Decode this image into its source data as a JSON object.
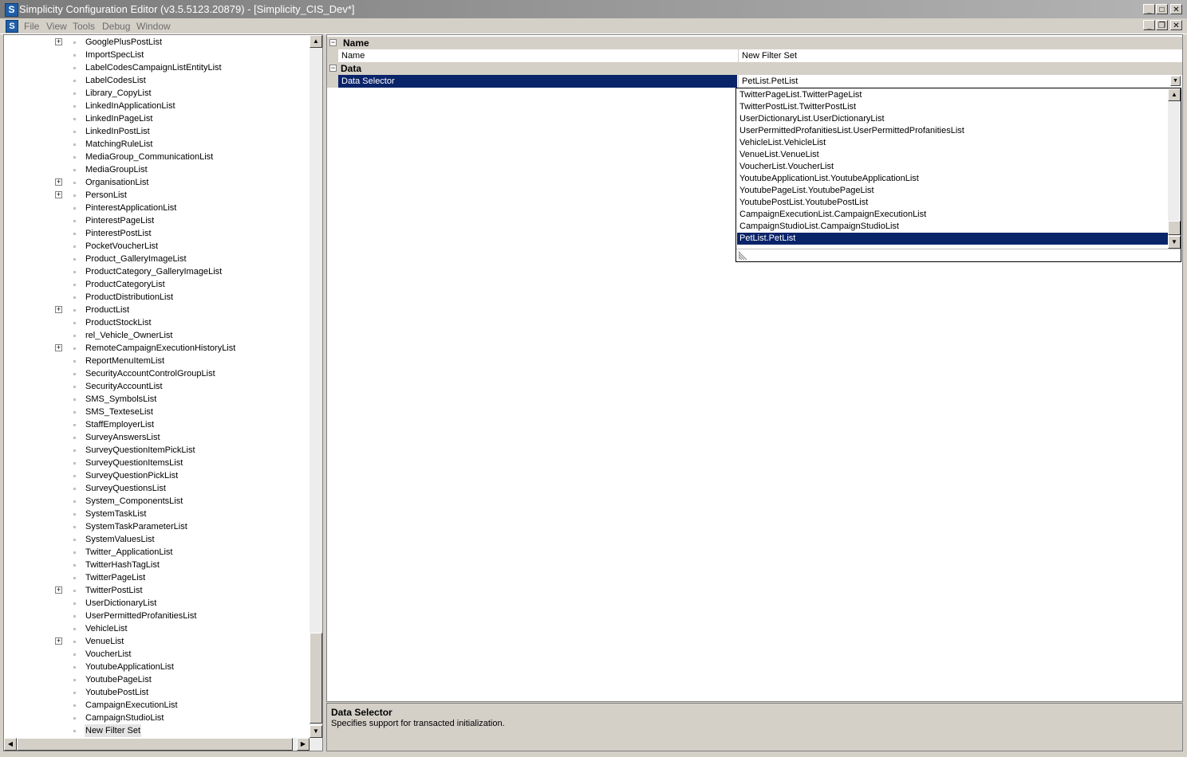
{
  "window": {
    "title": "Simplicity Configuration Editor (v3.5.5123.20879) - [Simplicity_CIS_Dev*]",
    "app_icon_letter": "S",
    "minimize_glyph": "_",
    "maximize_glyph": "□",
    "close_glyph": "✕",
    "restore_glyph": "❐"
  },
  "menu": [
    "File",
    "View",
    "Tools",
    "Debug",
    "Window"
  ],
  "tree": {
    "items": [
      {
        "label": "GooglePlusPostList",
        "expandable": true
      },
      {
        "label": "ImportSpecList",
        "expandable": false
      },
      {
        "label": "LabelCodesCampaignListEntityList",
        "expandable": false
      },
      {
        "label": "LabelCodesList",
        "expandable": false
      },
      {
        "label": "Library_CopyList",
        "expandable": false
      },
      {
        "label": "LinkedInApplicationList",
        "expandable": false
      },
      {
        "label": "LinkedInPageList",
        "expandable": false
      },
      {
        "label": "LinkedInPostList",
        "expandable": false
      },
      {
        "label": "MatchingRuleList",
        "expandable": false
      },
      {
        "label": "MediaGroup_CommunicationList",
        "expandable": false
      },
      {
        "label": "MediaGroupList",
        "expandable": false
      },
      {
        "label": "OrganisationList",
        "expandable": true
      },
      {
        "label": "PersonList",
        "expandable": true
      },
      {
        "label": "PinterestApplicationList",
        "expandable": false
      },
      {
        "label": "PinterestPageList",
        "expandable": false
      },
      {
        "label": "PinterestPostList",
        "expandable": false
      },
      {
        "label": "PocketVoucherList",
        "expandable": false
      },
      {
        "label": "Product_GalleryImageList",
        "expandable": false
      },
      {
        "label": "ProductCategory_GalleryImageList",
        "expandable": false
      },
      {
        "label": "ProductCategoryList",
        "expandable": false
      },
      {
        "label": "ProductDistributionList",
        "expandable": false
      },
      {
        "label": "ProductList",
        "expandable": true
      },
      {
        "label": "ProductStockList",
        "expandable": false
      },
      {
        "label": "rel_Vehicle_OwnerList",
        "expandable": false
      },
      {
        "label": "RemoteCampaignExecutionHistoryList",
        "expandable": true
      },
      {
        "label": "ReportMenuItemList",
        "expandable": false
      },
      {
        "label": "SecurityAccountControlGroupList",
        "expandable": false
      },
      {
        "label": "SecurityAccountList",
        "expandable": false
      },
      {
        "label": "SMS_SymbolsList",
        "expandable": false
      },
      {
        "label": "SMS_TexteseList",
        "expandable": false
      },
      {
        "label": "StaffEmployerList",
        "expandable": false
      },
      {
        "label": "SurveyAnswersList",
        "expandable": false
      },
      {
        "label": "SurveyQuestionItemPickList",
        "expandable": false
      },
      {
        "label": "SurveyQuestionItemsList",
        "expandable": false
      },
      {
        "label": "SurveyQuestionPickList",
        "expandable": false
      },
      {
        "label": "SurveyQuestionsList",
        "expandable": false
      },
      {
        "label": "System_ComponentsList",
        "expandable": false
      },
      {
        "label": "SystemTaskList",
        "expandable": false
      },
      {
        "label": "SystemTaskParameterList",
        "expandable": false
      },
      {
        "label": "SystemValuesList",
        "expandable": false
      },
      {
        "label": "Twitter_ApplicationList",
        "expandable": false
      },
      {
        "label": "TwitterHashTagList",
        "expandable": false
      },
      {
        "label": "TwitterPageList",
        "expandable": false
      },
      {
        "label": "TwitterPostList",
        "expandable": true
      },
      {
        "label": "UserDictionaryList",
        "expandable": false
      },
      {
        "label": "UserPermittedProfanitiesList",
        "expandable": false
      },
      {
        "label": "VehicleList",
        "expandable": false
      },
      {
        "label": "VenueList",
        "expandable": true
      },
      {
        "label": "VoucherList",
        "expandable": false
      },
      {
        "label": "YoutubeApplicationList",
        "expandable": false
      },
      {
        "label": "YoutubePageList",
        "expandable": false
      },
      {
        "label": "YoutubePostList",
        "expandable": false
      },
      {
        "label": "CampaignExecutionList",
        "expandable": false
      },
      {
        "label": "CampaignStudioList",
        "expandable": false
      },
      {
        "label": "New Filter Set",
        "expandable": false,
        "selected": true
      }
    ]
  },
  "property_grid": {
    "categories": [
      {
        "name": "Name",
        "collapse_glyph": "−"
      },
      {
        "name": "Data",
        "collapse_glyph": "−"
      }
    ],
    "properties": [
      {
        "name": "Name",
        "value": "New Filter Set"
      },
      {
        "name": "Data Selector",
        "value": "PetList.PetList"
      }
    ],
    "dropdown_items": [
      "TwitterPageList.TwitterPageList",
      "TwitterPostList.TwitterPostList",
      "UserDictionaryList.UserDictionaryList",
      "UserPermittedProfanitiesList.UserPermittedProfanitiesList",
      "VehicleList.VehicleList",
      "VenueList.VenueList",
      "VoucherList.VoucherList",
      "YoutubeApplicationList.YoutubeApplicationList",
      "YoutubePageList.YoutubePageList",
      "YoutubePostList.YoutubePostList",
      "CampaignExecutionList.CampaignExecutionList",
      "CampaignStudioList.CampaignStudioList",
      "PetList.PetList"
    ],
    "dropdown_selected": "PetList.PetList"
  },
  "help": {
    "title": "Data Selector",
    "description": "Specifies support for transacted initialization."
  },
  "colors": {
    "selection": "#0a246a",
    "chrome": "#d4d0c8"
  }
}
